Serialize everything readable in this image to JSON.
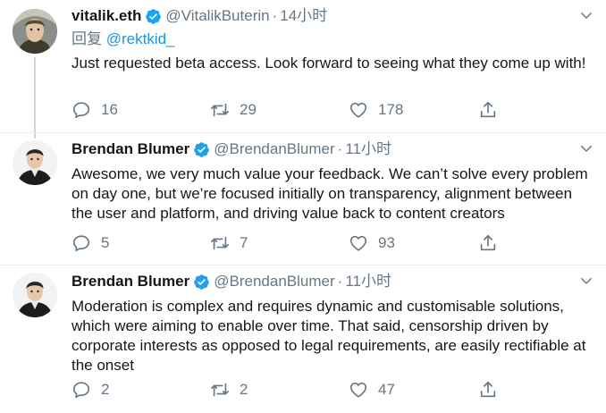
{
  "colors": {
    "text": "#14171a",
    "secondary": "#657786",
    "link": "#1b95e0",
    "verified": "#1da1f2",
    "thread_line": "#ccd6dd",
    "divider": "#e6ecf0"
  },
  "tweets": [
    {
      "display_name": "vitalik.eth",
      "handle": "@VitalikButerin",
      "separator": "·",
      "time": "14小时",
      "reply_prefix": "回复",
      "reply_mention": "@rektkid_",
      "text": "Just requested beta access. Look forward to seeing what they come up with!",
      "replies": "16",
      "retweets": "29",
      "likes": "178",
      "avatar_icon": "vitalik-avatar"
    },
    {
      "display_name": "Brendan Blumer",
      "handle": "@BrendanBlumer",
      "separator": "·",
      "time": "11小时",
      "text": "Awesome, we very much value your feedback. We can’t solve every problem on day one, but we’re focused initially on transparency, alignment between the user and platform, and driving value back to content creators",
      "replies": "5",
      "retweets": "7",
      "likes": "93",
      "avatar_icon": "brendan-avatar"
    },
    {
      "display_name": "Brendan Blumer",
      "handle": "@BrendanBlumer",
      "separator": "·",
      "time": "11小时",
      "text": "Moderation is complex and requires dynamic and customisable solutions, which were aiming to enable over time. That said, censorship driven by corporate interests as opposed to legal requirements, are easily rectifiable at the onset",
      "replies": "2",
      "retweets": "2",
      "likes": "47",
      "avatar_icon": "brendan-avatar"
    }
  ]
}
